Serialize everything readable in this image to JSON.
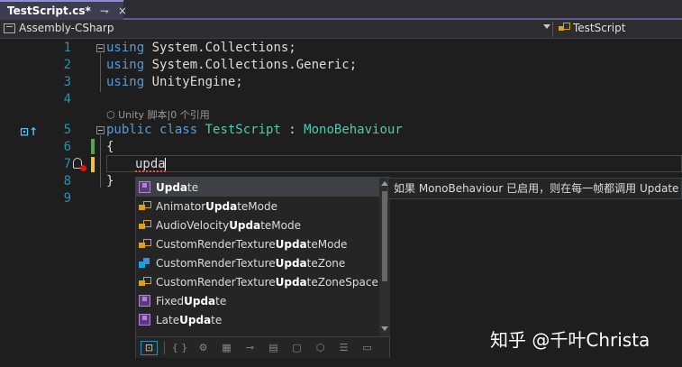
{
  "tab": {
    "title": "TestScript.cs*",
    "pin": "⇁",
    "close": "×"
  },
  "navbar": {
    "project": "Assembly-CSharp",
    "type_member": "TestScript"
  },
  "editor": {
    "lines": [
      {
        "num": "1",
        "kw": "using",
        "rest": " System.Collections;"
      },
      {
        "num": "2",
        "kw": "using",
        "rest": " System.Collections.Generic;"
      },
      {
        "num": "3",
        "kw": "using",
        "rest": " UnityEngine;"
      },
      {
        "num": "4"
      },
      {
        "num": "5",
        "kw": "public class",
        "type": " TestScript",
        "sep": " : ",
        "base": "MonoBehaviour"
      },
      {
        "num": "6",
        "text": "{"
      },
      {
        "num": "7",
        "text": "upda"
      },
      {
        "num": "8",
        "text": "}"
      },
      {
        "num": "9"
      }
    ],
    "codelens": "Unity 脚本|0 个引用",
    "marker": "⊡↑"
  },
  "completion": {
    "items": [
      {
        "pre": "",
        "match": "Upda",
        "post": "te",
        "icon": "method-cube-icon",
        "selected": true
      },
      {
        "pre": "Animator",
        "match": "Upda",
        "post": "teMode",
        "icon": "enum-icon"
      },
      {
        "pre": "AudioVelocity",
        "match": "Upda",
        "post": "teMode",
        "icon": "enum-icon"
      },
      {
        "pre": "CustomRenderTexture",
        "match": "Upda",
        "post": "teMode",
        "icon": "enum-icon"
      },
      {
        "pre": "CustomRenderTexture",
        "match": "Upda",
        "post": "teZone",
        "icon": "struct-icon"
      },
      {
        "pre": "CustomRenderTexture",
        "match": "Upda",
        "post": "teZoneSpace",
        "icon": "enum-icon"
      },
      {
        "pre": "Fixed",
        "match": "Upda",
        "post": "te",
        "icon": "method-cube-icon"
      },
      {
        "pre": "Late",
        "match": "Upda",
        "post": "te",
        "icon": "method-cube-icon"
      }
    ],
    "filters": [
      "⊡",
      "{ }",
      "⚙",
      "▦",
      "⊸",
      "▤",
      "▢",
      "⬡",
      "☰",
      "▭"
    ]
  },
  "tooltip": {
    "text": "如果 MonoBehaviour 已启用，则在每一帧都调用 Update"
  },
  "watermark": {
    "text": "知乎 @千叶Christa"
  }
}
